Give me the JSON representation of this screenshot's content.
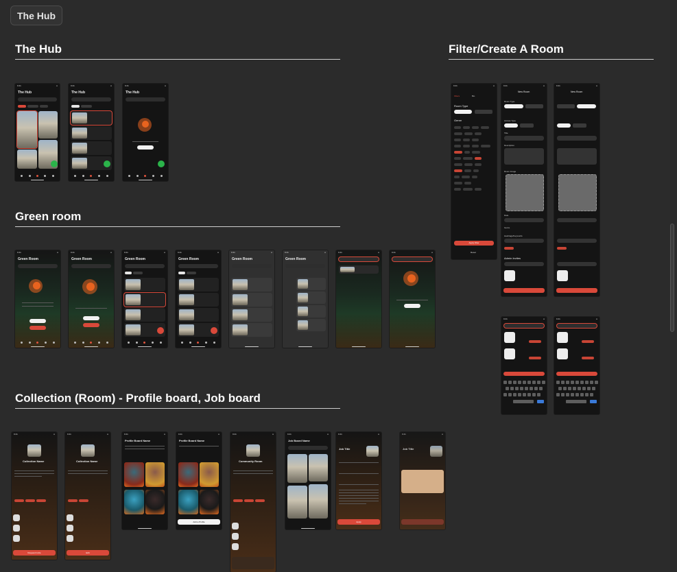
{
  "canvas": {
    "page_tag": "The Hub",
    "sections": [
      {
        "title": "The Hub"
      },
      {
        "title": "Green room"
      },
      {
        "title": "Collection (Room) - Profile board, Job board"
      },
      {
        "title": "Filter/Create A Room"
      }
    ]
  },
  "hub_screens": [
    {
      "title": "The Hub"
    },
    {
      "title": "The Hub"
    },
    {
      "title": "The Hub"
    }
  ],
  "green_screens": [
    {
      "title": "Green Room"
    },
    {
      "title": "Green Room"
    },
    {
      "title": "Green Room"
    },
    {
      "title": "Green Room"
    },
    {
      "title": "Green Room"
    },
    {
      "title": "Green Room"
    }
  ],
  "collection_screens": [
    {
      "title": "Collection Name"
    },
    {
      "title": "Collection Name"
    },
    {
      "title": "Profile Board Name"
    },
    {
      "title": "Profile Board Name"
    },
    {
      "title": "Community Room"
    },
    {
      "title": "Job Board Name"
    },
    {
      "title": "Job Title"
    },
    {
      "title": "Job Title"
    }
  ],
  "collection_buttons": {
    "request": "Request Invite",
    "edit": "Edit",
    "add_profile": "Add a Profile",
    "apply": "Apply"
  },
  "filter_screen": {
    "tabs": [
      "Filters",
      "Bio"
    ],
    "room_type_label": "Room Type",
    "room_types": [
      "Collection",
      "Community"
    ],
    "genre_label": "Genre",
    "apply": "Apply Filter",
    "reset": "Reset"
  },
  "new_room": {
    "title": "New Room",
    "room_type": "Room Type",
    "access_type": "Access Type",
    "title_label": "Title",
    "description": "Description",
    "room_image": "Room Image",
    "upload": "Upload Image",
    "date": "Date",
    "genre": "Genre",
    "hashtags": "Hashtags/Keywords",
    "admin_invites": "Admin Invites",
    "create": "Create Room"
  },
  "colors": {
    "background": "#2b2b2b",
    "accent_red": "#d9493a",
    "accent_green": "#2bb34a",
    "orange": "#e8631f"
  }
}
